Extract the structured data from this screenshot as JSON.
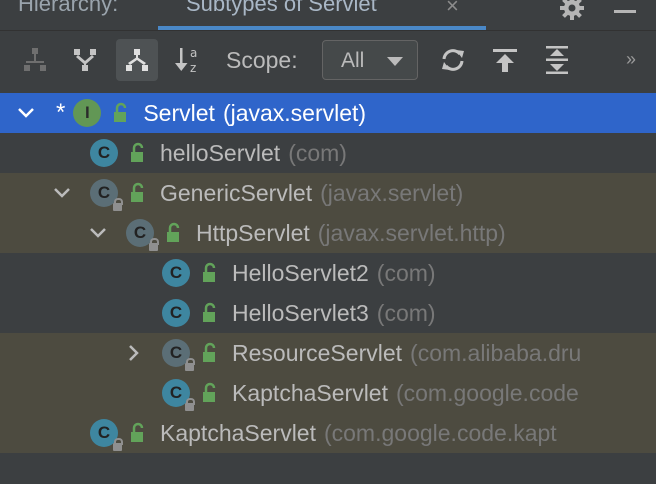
{
  "tabs": {
    "hierarchy_label": "Hierarchy:",
    "subtypes_label": "Subtypes of Servlet",
    "close_glyph": "×"
  },
  "toolbar": {
    "scope_label": "Scope:",
    "scope_value": "All",
    "more_glyph": "››",
    "buttons": [
      "class-hierarchy-icon",
      "supertypes-icon",
      "subtypes-icon",
      "sort-alpha-icon",
      "refresh-icon",
      "export-icon",
      "expand-all-icon"
    ]
  },
  "colors": {
    "selection": "#2f65ca",
    "shaded_row": "#4d4b40",
    "class_icon": "#3e86a0",
    "interface_icon": "#629755",
    "visibility_public": "#62a35a"
  },
  "tree": [
    {
      "name": "Servlet",
      "pkg": "(javax.servlet)",
      "kind": "interface",
      "expanded": true,
      "marker": "*",
      "icon_letter": "I"
    },
    {
      "name": "helloServlet",
      "pkg": "(com)",
      "kind": "class",
      "icon_letter": "C"
    },
    {
      "name": "GenericServlet",
      "pkg": "(javax.servlet)",
      "kind": "abstract-class",
      "expanded": true,
      "icon_letter": "C"
    },
    {
      "name": "HttpServlet",
      "pkg": "(javax.servlet.http)",
      "kind": "abstract-class",
      "expanded": true,
      "icon_letter": "C"
    },
    {
      "name": "HelloServlet2",
      "pkg": "(com)",
      "kind": "class",
      "icon_letter": "C"
    },
    {
      "name": "HelloServlet3",
      "pkg": "(com)",
      "kind": "class",
      "icon_letter": "C"
    },
    {
      "name": "ResourceServlet",
      "pkg": "(com.alibaba.dru",
      "kind": "abstract-class",
      "expanded": false,
      "icon_letter": "C"
    },
    {
      "name": "KaptchaServlet",
      "pkg": "(com.google.code",
      "kind": "class-locked",
      "icon_letter": "C"
    },
    {
      "name": "KaptchaServlet",
      "pkg": "(com.google.code.kapt",
      "kind": "class-locked",
      "icon_letter": "C"
    }
  ]
}
